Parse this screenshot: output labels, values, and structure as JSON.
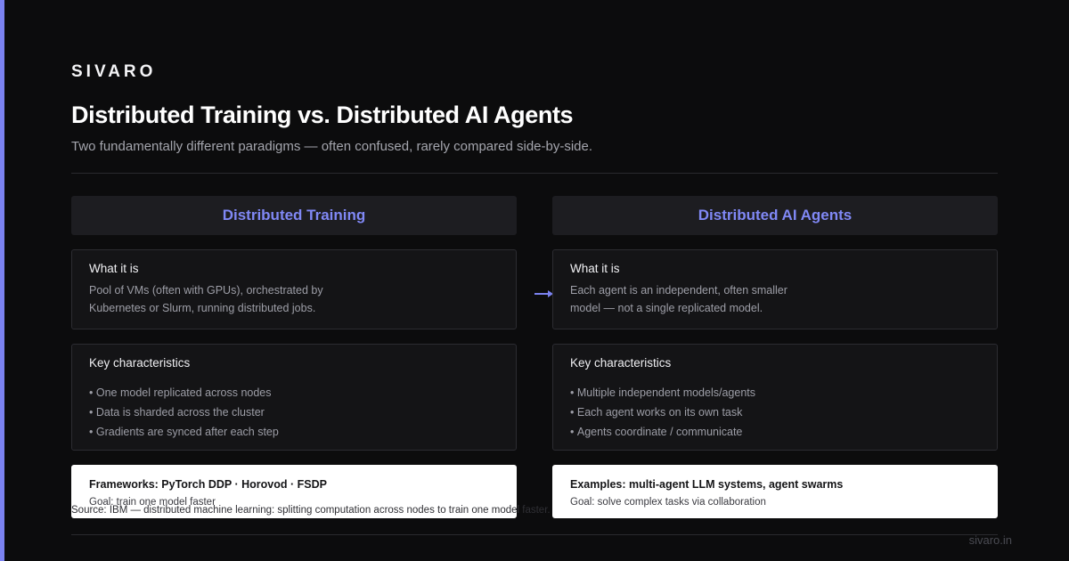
{
  "brand": "SIVARO",
  "title": "Distributed Training vs. Distributed AI Agents",
  "subtitle": "Two fundamentally different paradigms — often confused, rarely compared side-by-side.",
  "colors": {
    "accent": "#7b82f0",
    "header_text": "#8088f5",
    "background": "#0c0c0d"
  },
  "left": {
    "header": "Distributed Training",
    "what": {
      "title": "What it is",
      "line1": "Pool of VMs (often with GPUs), orchestrated by",
      "line2": "Kubernetes or Slurm, running distributed jobs."
    },
    "key": {
      "title": "Key characteristics",
      "items": [
        "One model replicated across nodes",
        "Data is sharded across the cluster",
        "Gradients are synced after each step"
      ]
    },
    "summary": {
      "title": "Frameworks: PyTorch DDP · Horovod · FSDP",
      "goal": "Goal: train one model faster"
    }
  },
  "right": {
    "header": "Distributed AI Agents",
    "what": {
      "title": "What it is",
      "line1": "Each agent is an independent, often smaller",
      "line2": "model — not a single replicated model."
    },
    "key": {
      "title": "Key characteristics",
      "items": [
        "Multiple independent models/agents",
        "Each agent works on its own task",
        "Agents coordinate / communicate"
      ]
    },
    "summary": {
      "title": "Examples: multi-agent LLM systems, agent swarms",
      "goal": "Goal: solve complex tasks via collaboration"
    }
  },
  "arrow_icon": "arrow-right-icon",
  "source": "Source: IBM — distributed machine learning: splitting computation across nodes to train one model faster.",
  "footer": "sivaro.in"
}
